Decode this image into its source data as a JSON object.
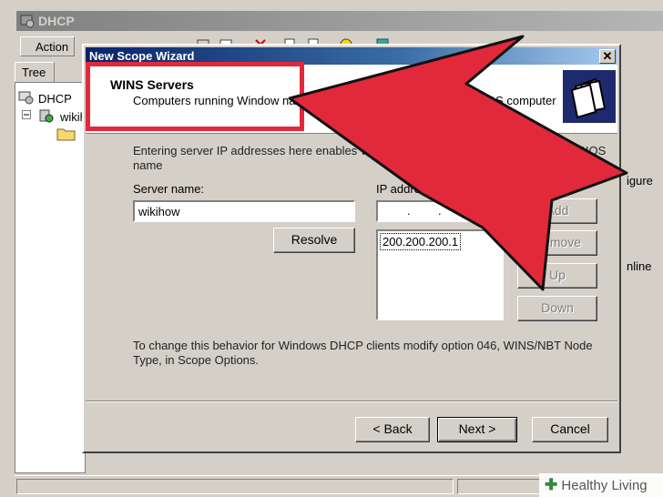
{
  "console": {
    "title": "DHCP",
    "menu_action": "Action",
    "tree_tab": "Tree",
    "tree_root": "DHCP",
    "tree_server": "wikih",
    "right_fragment_1": "igure",
    "right_fragment_2": "nline"
  },
  "wizard": {
    "title": "New Scope Wizard",
    "close_label": "✕",
    "header_title": "WINS Servers",
    "header_subtitle": "Computers running Window names to IP addresses.",
    "header_trailing": "OS computer",
    "intro_text": "Entering server IP addresses here enables Wi broadcasts to register and resolve NetBIOS name",
    "intro_trailing": "e",
    "server_name_label": "Server name:",
    "server_name_value": "wikihow",
    "ip_label": "IP addre",
    "ip_dot_1": ".",
    "ip_dot_2": ".",
    "resolve_label": "Resolve",
    "add_label": "Add",
    "remove_label": "Remove",
    "up_label": "Up",
    "down_label": "Down",
    "ip_list": [
      "200.200.200.1"
    ],
    "footer_text": "To change this behavior for Windows DHCP clients modify option 046, WINS/NBT Node Type, in Scope Options.",
    "back_label": "< Back",
    "next_label": "Next >",
    "cancel_label": "Cancel"
  },
  "watermark": {
    "plus": "✚",
    "text": "Healthy Living"
  },
  "colors": {
    "highlight": "#e2283b",
    "titlebar": "#0a246a",
    "window_bg": "#d4d0c8"
  }
}
